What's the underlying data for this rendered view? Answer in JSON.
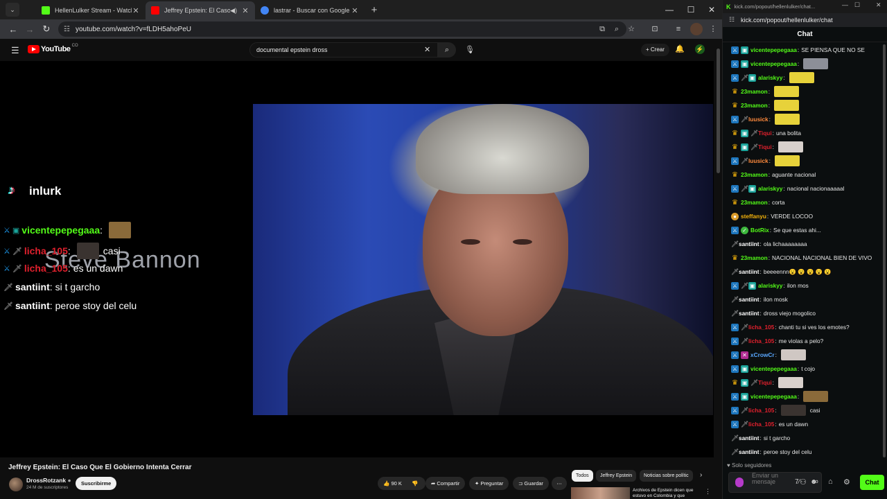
{
  "browser_left": {
    "tabs": [
      {
        "title": "HellenLulker Stream - Watch Li",
        "favicon_color": "#53fc18"
      },
      {
        "title": "Jeffrey Epstein: El Caso Que",
        "favicon_color": "#ff0000"
      },
      {
        "title": "lastrar - Buscar con Google",
        "favicon_color": "#4285f4"
      }
    ],
    "url": "youtube.com/watch?v=fLDH5ahoPeU"
  },
  "youtube": {
    "logo_text": "YouTube",
    "logo_country": "CO",
    "search_query": "documental epstein dross",
    "create_label": "Crear",
    "video_title": "Jeffrey Epstein: El Caso Que El Gobierno Intenta Cerrar",
    "channel_name": "DrossRotzank",
    "channel_subs": "24 M de suscriptores",
    "subscribe_label": "Suscribirme",
    "like_count": "90 K",
    "share_label": "Compartir",
    "ask_label": "Preguntar",
    "save_label": "Guardar",
    "chips": [
      "Todos",
      "Jeffrey Epstein",
      "Noticias sobre polític"
    ],
    "rec_title": "Archivos de Epstein dicen que estuvo en Colombia y que"
  },
  "overlay": {
    "brand": "inlurk",
    "caption": "Steve Bannon",
    "lines": [
      {
        "user": "vicentepepegaaa",
        "text": "",
        "color": "#53fc18",
        "emote": "#8a6a3a"
      },
      {
        "user": "licha_105",
        "text": "casi",
        "color": "#e0202d",
        "emote": "#3a3330"
      },
      {
        "user": "licha_105",
        "text": "es un dawn",
        "color": "#e0202d",
        "emote": ""
      },
      {
        "user": "santiint",
        "text": "si t garcho",
        "color": "#ffffff",
        "emote": ""
      },
      {
        "user": "santiint",
        "text": "peroe stoy del celu",
        "color": "#ffffff",
        "emote": ""
      }
    ]
  },
  "kick": {
    "window_title": "kick.com/popout/hellenlulker/chat...",
    "url": "kick.com/popout/hellenlulker/chat",
    "header": "Chat",
    "messages": [
      {
        "badges": [
          "sword",
          "sub"
        ],
        "user": "vicentepepegaaa",
        "color": "#53fc18",
        "text": "SE PIENSA QUE NO SE",
        "emote": ""
      },
      {
        "badges": [
          "sword",
          "sub"
        ],
        "user": "vicentepepegaaa",
        "color": "#53fc18",
        "text": "",
        "emote": "#8c8f98"
      },
      {
        "badges": [
          "sword",
          "eb",
          "sub"
        ],
        "user": "alariskyy",
        "color": "#53fc18",
        "text": "",
        "emote": "#e7d23a"
      },
      {
        "badges": [
          "crown"
        ],
        "user": "23mamon",
        "color": "#53fc18",
        "text": "",
        "emote": "#e7d23a"
      },
      {
        "badges": [
          "crown"
        ],
        "user": "23mamon",
        "color": "#53fc18",
        "text": "",
        "emote": "#e7d23a"
      },
      {
        "badges": [
          "sword",
          "eb"
        ],
        "user": "luusick",
        "color": "#ff8a3d",
        "text": "",
        "emote": "#e7d23a"
      },
      {
        "badges": [
          "crown",
          "sub",
          "eb"
        ],
        "user": "Tiqui",
        "color": "#e0202d",
        "text": "una bolita",
        "emote": ""
      },
      {
        "badges": [
          "crown",
          "sub",
          "eb"
        ],
        "user": "Tiqui",
        "color": "#e0202d",
        "text": "",
        "emote": "#d8d0cc"
      },
      {
        "badges": [
          "sword",
          "eb"
        ],
        "user": "luusick",
        "color": "#ff8a3d",
        "text": "",
        "emote": "#e7d23a"
      },
      {
        "badges": [
          "crown"
        ],
        "user": "23mamon",
        "color": "#53fc18",
        "text": "aguante nacional",
        "emote": ""
      },
      {
        "badges": [
          "sword",
          "eb",
          "sub"
        ],
        "user": "alariskyy",
        "color": "#53fc18",
        "text": "nacional nacionaaaaal",
        "emote": ""
      },
      {
        "badges": [
          "crown"
        ],
        "user": "23mamon",
        "color": "#53fc18",
        "text": "corta",
        "emote": ""
      },
      {
        "badges": [
          "dl"
        ],
        "user": "steffanyu",
        "color": "#f5b40b",
        "text": "VERDE LOCOO",
        "emote": ""
      },
      {
        "badges": [
          "sword",
          "mod"
        ],
        "user": "BotRix",
        "color": "#53fc18",
        "text": "Se que estas ahi...",
        "emote": ""
      },
      {
        "badges": [
          "eb"
        ],
        "user": "santiint",
        "color": "#ffffff",
        "text": "ola lichaaaaaaaa",
        "emote": ""
      },
      {
        "badges": [
          "crown"
        ],
        "user": "23mamon",
        "color": "#53fc18",
        "text": "NACIONAL NACIONAL BIEN DE VIVO",
        "emote": ""
      },
      {
        "badges": [
          "eb"
        ],
        "user": "santiint",
        "color": "#ffffff",
        "text": "beeeennn😮 😮 😮 😮 😮",
        "emote": ""
      },
      {
        "badges": [
          "sword",
          "eb",
          "sub"
        ],
        "user": "alariskyy",
        "color": "#53fc18",
        "text": "ilon mos",
        "emote": ""
      },
      {
        "badges": [
          "eb"
        ],
        "user": "santiint",
        "color": "#ffffff",
        "text": "ilon mosk",
        "emote": ""
      },
      {
        "badges": [
          "eb"
        ],
        "user": "santiint",
        "color": "#ffffff",
        "text": "dross viejo mogolico",
        "emote": ""
      },
      {
        "badges": [
          "sword",
          "eb"
        ],
        "user": "licha_105",
        "color": "#e0202d",
        "text": "chanti tu si ves los emotes?",
        "emote": ""
      },
      {
        "badges": [
          "sword",
          "eb"
        ],
        "user": "licha_105",
        "color": "#e0202d",
        "text": "me violas a pelo?",
        "emote": ""
      },
      {
        "badges": [
          "sword",
          "xc"
        ],
        "user": "xCrowCr",
        "color": "#5aa8ff",
        "text": "",
        "emote": "#cfc7c3"
      },
      {
        "badges": [
          "sword",
          "sub"
        ],
        "user": "vicentepepegaaa",
        "color": "#53fc18",
        "text": "t cojo",
        "emote": ""
      },
      {
        "badges": [
          "crown",
          "sub",
          "eb"
        ],
        "user": "Tiqui",
        "color": "#e0202d",
        "text": "",
        "emote": "#d8d0cc"
      },
      {
        "badges": [
          "sword",
          "sub"
        ],
        "user": "vicentepepegaaa",
        "color": "#53fc18",
        "text": "",
        "emote": "#8a6a3a"
      },
      {
        "badges": [
          "sword",
          "eb"
        ],
        "user": "licha_105",
        "color": "#e0202d",
        "text": "casi",
        "emote": "#3a3330"
      },
      {
        "badges": [
          "sword",
          "eb"
        ],
        "user": "licha_105",
        "color": "#e0202d",
        "text": "es un dawn",
        "emote": ""
      },
      {
        "badges": [
          "eb"
        ],
        "user": "santiint",
        "color": "#ffffff",
        "text": "si t garcho",
        "emote": ""
      },
      {
        "badges": [
          "eb"
        ],
        "user": "santiint",
        "color": "#ffffff",
        "text": "peroe stoy del celu",
        "emote": ""
      }
    ],
    "followers_mode": "Solo seguidores",
    "input_placeholder": "Enviar un mensaje",
    "send_label": "Chat",
    "accent": "#53fc18"
  }
}
